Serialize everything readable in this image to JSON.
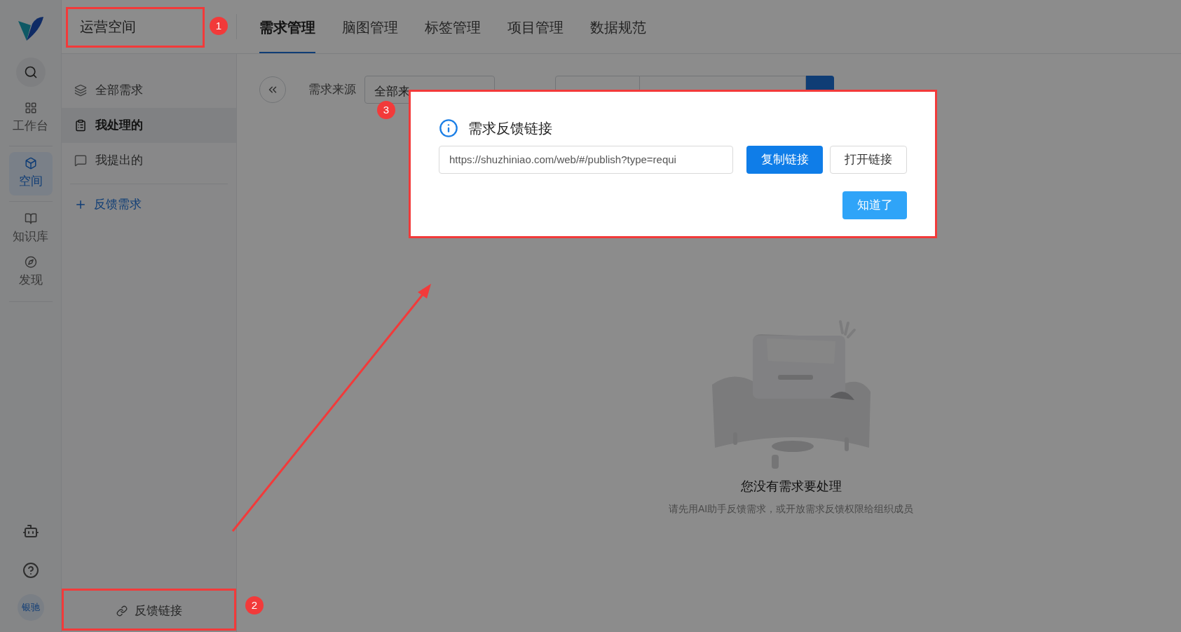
{
  "rail": {
    "items": [
      {
        "label": "工作台",
        "kind": "dashboard",
        "selected": false
      },
      {
        "label": "空间",
        "kind": "cube",
        "selected": true
      },
      {
        "label": "知识库",
        "kind": "book",
        "selected": false
      },
      {
        "label": "发现",
        "kind": "compass",
        "selected": false
      }
    ],
    "avatar": "银驰"
  },
  "space_name": "运营空间",
  "tabs": [
    {
      "label": "需求管理",
      "selected": true
    },
    {
      "label": "脑图管理",
      "selected": false
    },
    {
      "label": "标签管理",
      "selected": false
    },
    {
      "label": "项目管理",
      "selected": false
    },
    {
      "label": "数据规范",
      "selected": false
    }
  ],
  "sidebar": {
    "items": [
      {
        "label": "全部需求",
        "kind": "layers",
        "selected": false
      },
      {
        "label": "我处理的",
        "kind": "clipboard",
        "selected": true
      },
      {
        "label": "我提出的",
        "kind": "message",
        "selected": false
      }
    ],
    "action": "反馈需求",
    "footer_link": "反馈链接"
  },
  "filter": {
    "source_label": "需求来源",
    "source_value": "全部来"
  },
  "empty": {
    "title": "您没有需求要处理",
    "hint": "请先用AI助手反馈需求，或开放需求反馈权限给组织成员"
  },
  "dialog": {
    "title": "需求反馈链接",
    "url": "https://shuzhiniao.com/web/#/publish?type=requi",
    "buttons": [
      {
        "label": "复制链接",
        "kind": "primary"
      },
      {
        "label": "打开链接",
        "kind": "default"
      }
    ],
    "confirm": "知道了"
  },
  "annotations": [
    {
      "label": "1"
    },
    {
      "label": "2"
    },
    {
      "label": "3"
    }
  ]
}
